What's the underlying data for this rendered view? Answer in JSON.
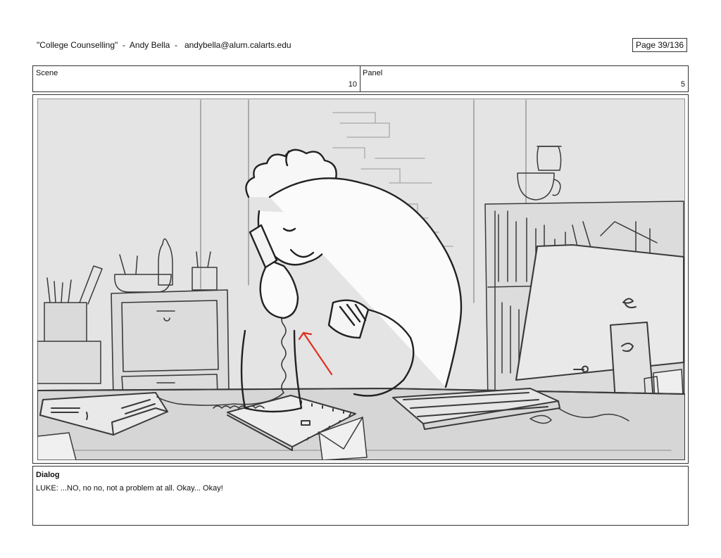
{
  "header": {
    "title_line": "\"College Counselling\"  -  Andy Bella  -   andybella@alum.calarts.edu",
    "page": "Page  39/136"
  },
  "meta": {
    "scene_label": "Scene",
    "scene_number": "10",
    "panel_label": "Panel",
    "panel_number": "5"
  },
  "dialog": {
    "label": "Dialog",
    "text": "LUKE: ...NO, no no, not a problem at all. Okay... Okay!"
  },
  "colors": {
    "sketch_bg": "#e4e4e4",
    "line": "#3a3a3a",
    "accent_arrow": "#e0301e"
  }
}
